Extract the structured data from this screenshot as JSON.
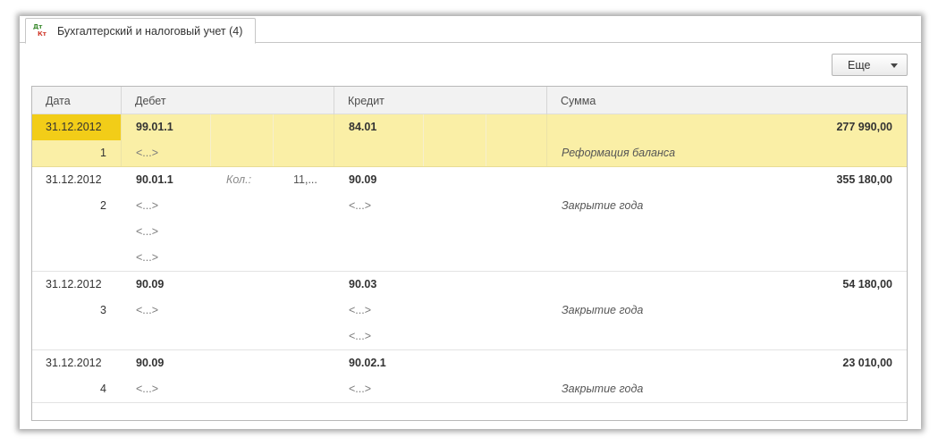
{
  "tab": {
    "icon_top": "Дт",
    "icon_bottom": "Кт",
    "title": "Бухгалтерский и налоговый учет (4)"
  },
  "toolbar": {
    "more_label": "Еще"
  },
  "columns": {
    "date": "Дата",
    "debit": "Дебет",
    "credit": "Кредит",
    "sum": "Сумма"
  },
  "records": [
    {
      "date": "31.12.2012",
      "num": "1",
      "debit": "99.01.1",
      "credit": "84.01",
      "sum": "277 990,00",
      "debit_sub": [
        "<...>"
      ],
      "credit_sub": [],
      "comment": "Реформация баланса",
      "selected": true
    },
    {
      "date": "31.12.2012",
      "num": "2",
      "debit": "90.01.1",
      "qty_label": "Кол.:",
      "qty_value": "11,...",
      "credit": "90.09",
      "sum": "355 180,00",
      "debit_sub": [
        "<...>",
        "<...>",
        "<...>"
      ],
      "credit_sub": [
        "<...>"
      ],
      "comment": "Закрытие года"
    },
    {
      "date": "31.12.2012",
      "num": "3",
      "debit": "90.09",
      "credit": "90.03",
      "sum": "54 180,00",
      "debit_sub": [
        "<...>"
      ],
      "credit_sub": [
        "<...>",
        "<...>"
      ],
      "comment": "Закрытие года"
    },
    {
      "date": "31.12.2012",
      "num": "4",
      "debit": "90.09",
      "credit": "90.02.1",
      "sum": "23 010,00",
      "debit_sub": [
        "<...>"
      ],
      "credit_sub": [
        "<...>"
      ],
      "comment": "Закрытие года"
    }
  ],
  "colors": {
    "selection": "#faefa6",
    "selected_cell": "#f2cd18"
  }
}
